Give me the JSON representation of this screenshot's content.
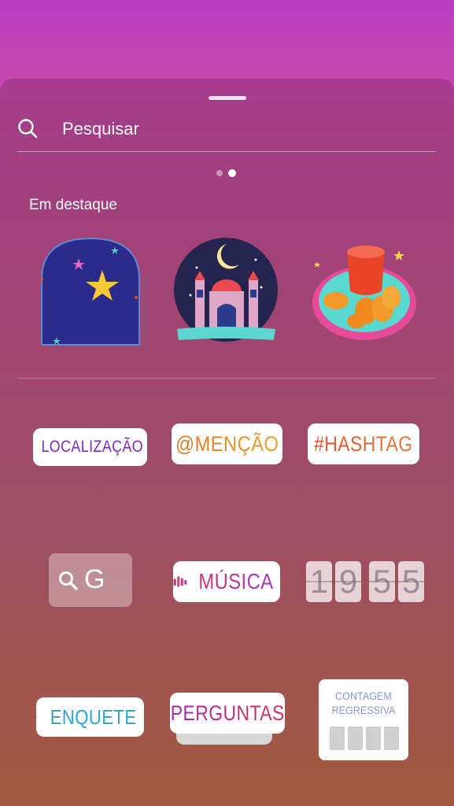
{
  "search": {
    "placeholder": "Pesquisar"
  },
  "featured": {
    "title": "Em destaque"
  },
  "stickers": {
    "location": "LOCALIZAÇÃO",
    "mention": "@MENÇÃO",
    "hashtag": "#HASHTAG",
    "gif": "G",
    "music": "MÚSICA",
    "clock_digits": [
      "1",
      "9",
      "5",
      "5"
    ],
    "poll": "ENQUETE",
    "questions": "PERGUNTAS",
    "countdown": "CONTAGEM REGRESSIVA"
  },
  "pager": {
    "pages": 2,
    "active": 2
  }
}
